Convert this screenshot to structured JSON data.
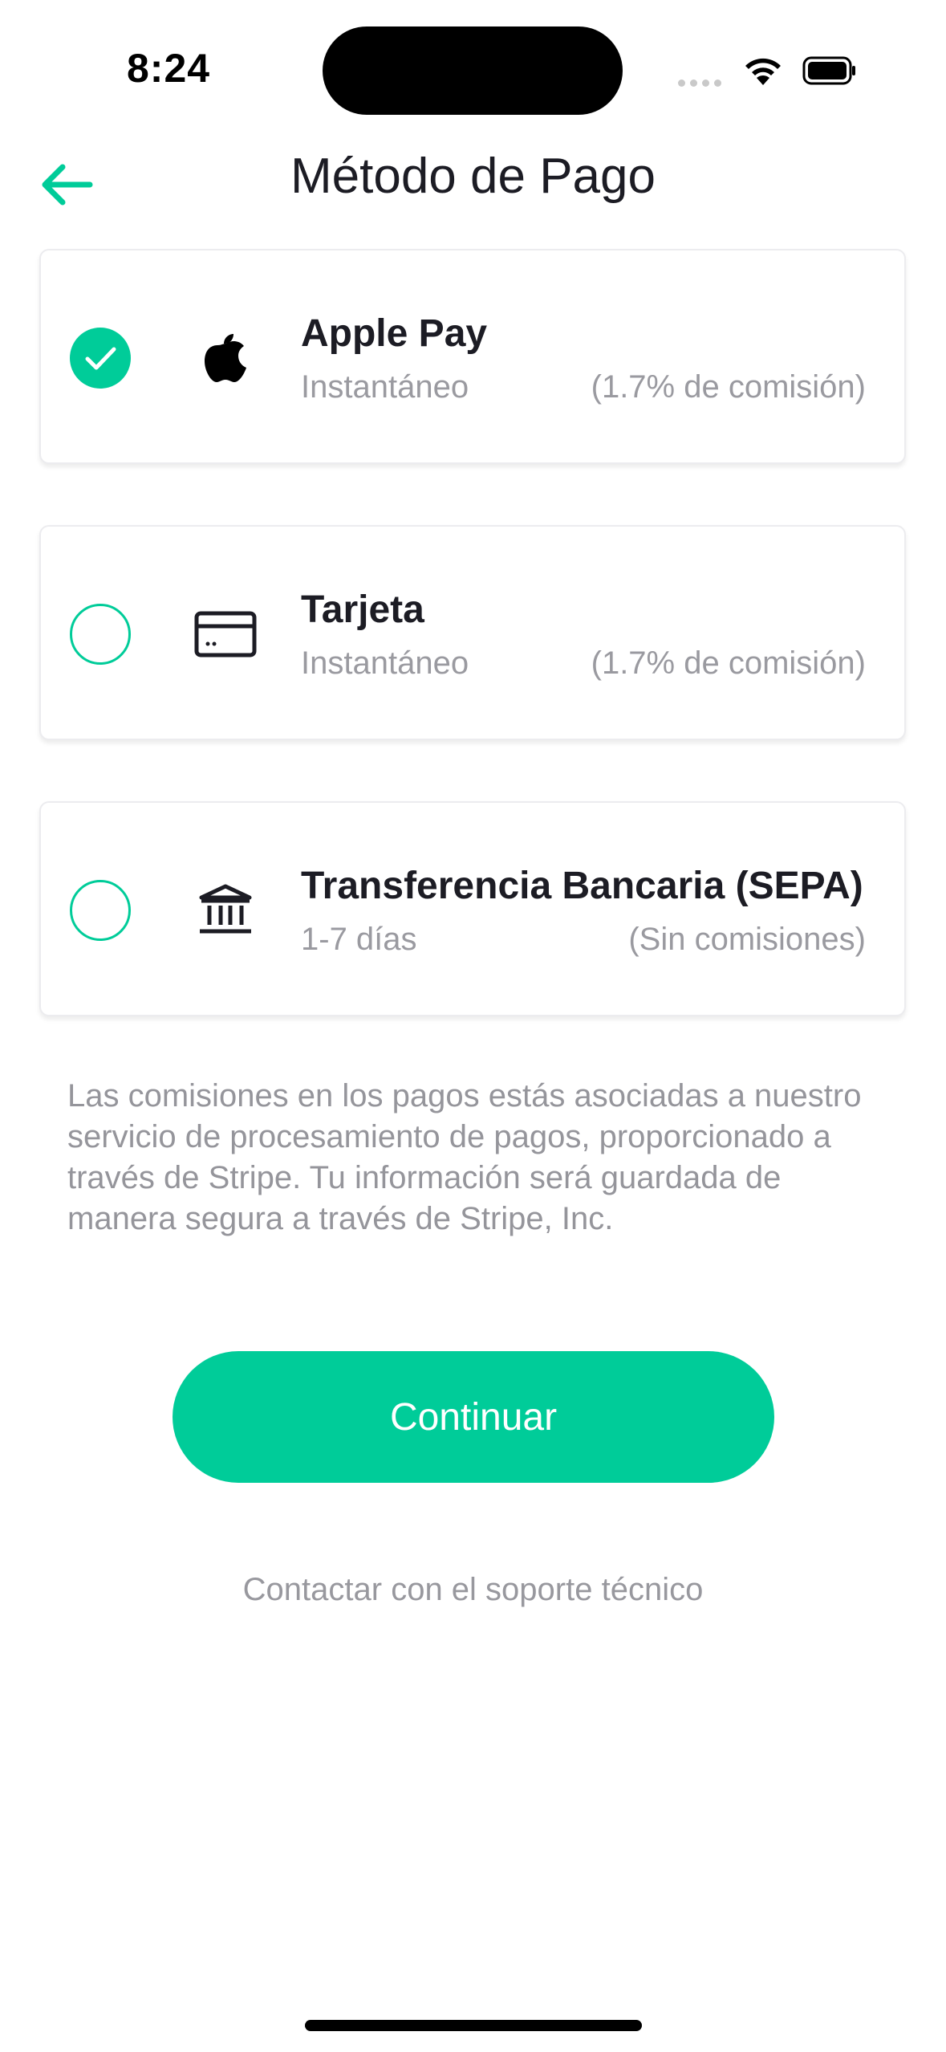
{
  "status_bar": {
    "time": "8:24"
  },
  "header": {
    "title": "Método de Pago"
  },
  "methods": [
    {
      "name": "Apple Pay",
      "speed": "Instantáneo",
      "fee": "(1.7% de comisión)",
      "selected": true,
      "icon": "apple-icon"
    },
    {
      "name": "Tarjeta",
      "speed": "Instantáneo",
      "fee": "(1.7% de comisión)",
      "selected": false,
      "icon": "credit-card-icon"
    },
    {
      "name": "Transferencia Bancaria (SEPA)",
      "speed": "1-7 días",
      "fee": "(Sin comisiones)",
      "selected": false,
      "icon": "bank-icon"
    }
  ],
  "note": "Las comisiones en los pagos estás asociadas a nuestro servicio de procesamiento de pagos, proporcionado a través de Stripe. Tu información será guardada de manera segura a través de Stripe, Inc.",
  "actions": {
    "continue_label": "Continuar",
    "support_label": "Contactar con el soporte técnico"
  },
  "colors": {
    "accent": "#00cc99",
    "text": "#1c1c24",
    "muted": "#9a9aa0"
  }
}
